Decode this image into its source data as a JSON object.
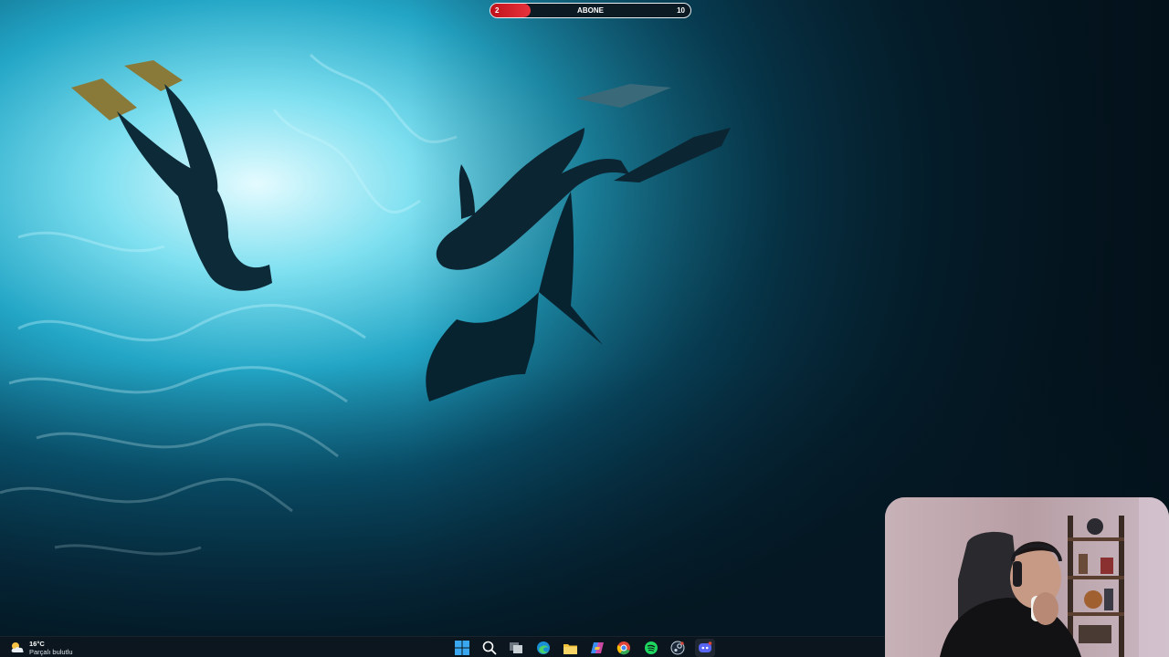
{
  "stream_overlay": {
    "goal": {
      "label": "ABONE",
      "current": "2",
      "target": "10",
      "progress": 0.2,
      "fill_color": "#d8202a"
    }
  },
  "video": {
    "scene": "underwater",
    "colors": {
      "water_light": "#2fb6d2",
      "water_deep": "#041722"
    }
  },
  "taskbar": {
    "weather": {
      "temperature": "16°C",
      "condition": "Parçalı bulutlu",
      "icon": "partly-cloudy-icon"
    },
    "apps": [
      {
        "name": "start",
        "icon": "windows-start-icon"
      },
      {
        "name": "search",
        "icon": "search-icon"
      },
      {
        "name": "task-view",
        "icon": "task-view-icon"
      },
      {
        "name": "edge",
        "icon": "edge-browser-icon"
      },
      {
        "name": "file-explorer",
        "icon": "folder-icon"
      },
      {
        "name": "copilot",
        "icon": "copilot-icon"
      },
      {
        "name": "chrome",
        "icon": "chrome-icon"
      },
      {
        "name": "spotify",
        "icon": "spotify-icon"
      },
      {
        "name": "steam",
        "icon": "steam-icon"
      },
      {
        "name": "discord",
        "icon": "discord-icon"
      }
    ]
  }
}
